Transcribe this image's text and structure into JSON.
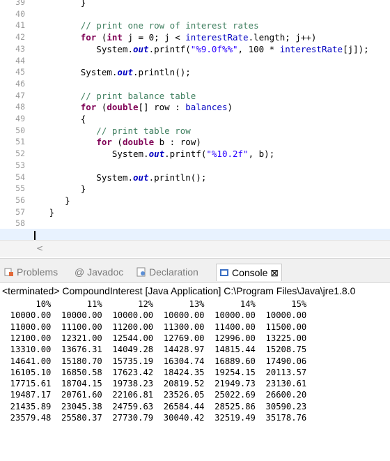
{
  "editor": {
    "lines": [
      {
        "n": "39",
        "code": [
          {
            "t": "         }",
            "c": ""
          }
        ]
      },
      {
        "n": "40",
        "code": []
      },
      {
        "n": "41",
        "code": [
          {
            "t": "         // print one row of interest rates",
            "c": "cm"
          }
        ]
      },
      {
        "n": "42",
        "code": [
          {
            "t": "         ",
            "c": ""
          },
          {
            "t": "for",
            "c": "kw"
          },
          {
            "t": " (",
            "c": ""
          },
          {
            "t": "int",
            "c": "kw"
          },
          {
            "t": " j = 0; j < ",
            "c": ""
          },
          {
            "t": "interestRate",
            "c": "fld"
          },
          {
            "t": ".length; j++)",
            "c": ""
          }
        ]
      },
      {
        "n": "43",
        "code": [
          {
            "t": "            System.",
            "c": ""
          },
          {
            "t": "out",
            "c": "sf"
          },
          {
            "t": ".printf(",
            "c": ""
          },
          {
            "t": "\"%9.0f%%\"",
            "c": "str"
          },
          {
            "t": ", 100 * ",
            "c": ""
          },
          {
            "t": "interestRate",
            "c": "fld"
          },
          {
            "t": "[j]);",
            "c": ""
          }
        ]
      },
      {
        "n": "44",
        "code": []
      },
      {
        "n": "45",
        "code": [
          {
            "t": "         System.",
            "c": ""
          },
          {
            "t": "out",
            "c": "sf"
          },
          {
            "t": ".println();",
            "c": ""
          }
        ]
      },
      {
        "n": "46",
        "code": []
      },
      {
        "n": "47",
        "code": [
          {
            "t": "         // print balance table",
            "c": "cm"
          }
        ]
      },
      {
        "n": "48",
        "code": [
          {
            "t": "         ",
            "c": ""
          },
          {
            "t": "for",
            "c": "kw"
          },
          {
            "t": " (",
            "c": ""
          },
          {
            "t": "double",
            "c": "kw"
          },
          {
            "t": "[] row : ",
            "c": ""
          },
          {
            "t": "balances",
            "c": "fld"
          },
          {
            "t": ")",
            "c": ""
          }
        ]
      },
      {
        "n": "49",
        "code": [
          {
            "t": "         {",
            "c": ""
          }
        ]
      },
      {
        "n": "50",
        "code": [
          {
            "t": "            // print table row",
            "c": "cm"
          }
        ]
      },
      {
        "n": "51",
        "code": [
          {
            "t": "            ",
            "c": ""
          },
          {
            "t": "for",
            "c": "kw"
          },
          {
            "t": " (",
            "c": ""
          },
          {
            "t": "double",
            "c": "kw"
          },
          {
            "t": " b : row)",
            "c": ""
          }
        ]
      },
      {
        "n": "52",
        "code": [
          {
            "t": "               System.",
            "c": ""
          },
          {
            "t": "out",
            "c": "sf"
          },
          {
            "t": ".printf(",
            "c": ""
          },
          {
            "t": "\"%10.2f\"",
            "c": "str"
          },
          {
            "t": ", b);",
            "c": ""
          }
        ]
      },
      {
        "n": "53",
        "code": []
      },
      {
        "n": "54",
        "code": [
          {
            "t": "            System.",
            "c": ""
          },
          {
            "t": "out",
            "c": "sf"
          },
          {
            "t": ".println();",
            "c": ""
          }
        ]
      },
      {
        "n": "55",
        "code": [
          {
            "t": "         }",
            "c": ""
          }
        ]
      },
      {
        "n": "56",
        "code": [
          {
            "t": "      }",
            "c": ""
          }
        ]
      },
      {
        "n": "57",
        "code": [
          {
            "t": "   }",
            "c": ""
          }
        ]
      },
      {
        "n": "58",
        "code": []
      }
    ]
  },
  "tabs": [
    {
      "label": "Problems",
      "icon": "problems-icon",
      "active": false
    },
    {
      "label": "@ Javadoc",
      "icon": "",
      "active": false
    },
    {
      "label": "Declaration",
      "icon": "declaration-icon",
      "active": false
    },
    {
      "label": "Console ⊠",
      "icon": "console-icon",
      "active": true
    }
  ],
  "status": {
    "text": "<terminated> CompoundInterest [Java Application] C:\\Program Files\\Java\\jre1.8.0"
  },
  "console": {
    "lines": [
      "       10%       11%       12%       13%       14%       15%",
      "  10000.00  10000.00  10000.00  10000.00  10000.00  10000.00",
      "  11000.00  11100.00  11200.00  11300.00  11400.00  11500.00",
      "  12100.00  12321.00  12544.00  12769.00  12996.00  13225.00",
      "  13310.00  13676.31  14049.28  14428.97  14815.44  15208.75",
      "  14641.00  15180.70  15735.19  16304.74  16889.60  17490.06",
      "  16105.10  16850.58  17623.42  18424.35  19254.15  20113.57",
      "  17715.61  18704.15  19738.23  20819.52  21949.73  23130.61",
      "  19487.17  20761.60  22106.81  23526.05  25022.69  26600.20",
      "  21435.89  23045.38  24759.63  26584.44  28525.86  30590.23",
      "  23579.48  25580.37  27730.79  30040.42  32519.49  35178.76"
    ]
  },
  "colors": {
    "keyword": "#7f0055",
    "comment": "#3f7f5f",
    "string": "#2a00ff",
    "field": "#0000c0"
  }
}
